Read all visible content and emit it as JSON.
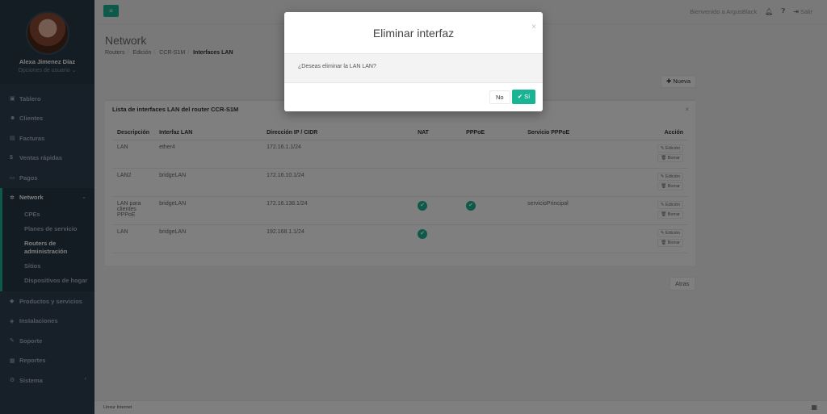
{
  "sidebar": {
    "user_name": "Alexa Jimenez Díaz",
    "user_options": "Opciones de usuario",
    "items": [
      {
        "label": "Tablero",
        "icon": "dashboard-icon"
      },
      {
        "label": "Clientes",
        "icon": "users-icon"
      },
      {
        "label": "Facturas",
        "icon": "invoice-icon"
      },
      {
        "label": "Ventas rápidas",
        "icon": "dollar-icon"
      },
      {
        "label": "Pagos",
        "icon": "money-icon"
      },
      {
        "label": "Network",
        "icon": "network-icon"
      },
      {
        "label": "Productos y servicios",
        "icon": "tag-icon"
      },
      {
        "label": "Instalaciones",
        "icon": "installations-icon"
      },
      {
        "label": "Soporte",
        "icon": "wrench-icon"
      },
      {
        "label": "Reportes",
        "icon": "reports-icon"
      },
      {
        "label": "Sistema",
        "icon": "cogs-icon"
      }
    ],
    "network_sub": [
      "CPEs",
      "Planes de servicio",
      "Routers de administración",
      "Sitios",
      "Dispositivos de hogar"
    ]
  },
  "topbar": {
    "welcome": "Bienvenido a ArgusBlack",
    "logout": "Salir"
  },
  "header": {
    "title": "Network",
    "breadcrumbs": [
      "Routers",
      "Edición",
      "CCR-S1M",
      "Interfaces LAN"
    ]
  },
  "actions": {
    "new_label": "Nueva",
    "back_label": "Atras"
  },
  "panel": {
    "title": "Lista de interfaces LAN del router CCR-S1M",
    "columns": [
      "Descripción",
      "Interfaz LAN",
      "Dirección IP / CIDR",
      "NAT",
      "PPPoE",
      "Servicio PPPoE",
      "Acción"
    ],
    "edit_label": "Edición",
    "delete_label": "Borrar",
    "rows": [
      {
        "descripcion": "LAN",
        "interfaz": "ether4",
        "ip": "172.16.1.1/24",
        "nat": false,
        "pppoe": false,
        "servicio": ""
      },
      {
        "descripcion": "LAN2",
        "interfaz": "bridgeLAN",
        "ip": "172.16.10.1/24",
        "nat": false,
        "pppoe": false,
        "servicio": ""
      },
      {
        "descripcion": "LAN para clientes PPPoE",
        "interfaz": "bridgeLAN",
        "ip": "172.16.138.1/24",
        "nat": true,
        "pppoe": true,
        "servicio": "servicioPrincipal"
      },
      {
        "descripcion": "LAN",
        "interfaz": "bridgeLAN",
        "ip": "192.168.1.1/24",
        "nat": true,
        "pppoe": false,
        "servicio": ""
      }
    ]
  },
  "footer": {
    "text": "Linxur Internet"
  },
  "modal": {
    "title": "Eliminar interfaz",
    "message": "¿Deseas eliminar la LAN LAN?",
    "no_label": "No",
    "yes_label": "Sí"
  },
  "colors": {
    "accent": "#1ab394",
    "sidebar": "#2f4050"
  }
}
